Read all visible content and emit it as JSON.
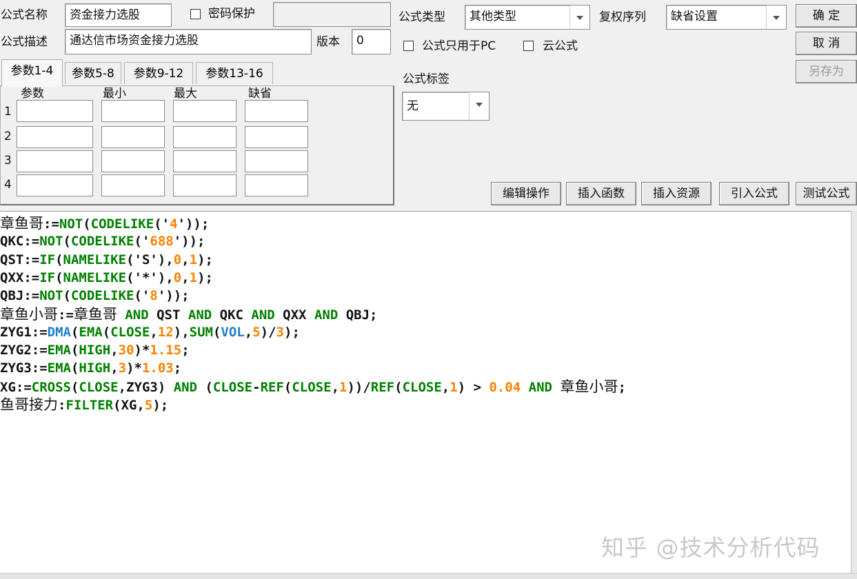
{
  "form": {
    "name_label": "公式名称",
    "name_value": "资金接力选股",
    "password_label": "密码保护",
    "password_value": "",
    "desc_label": "公式描述",
    "desc_value": "通达信市场资金接力选股",
    "version_label": "版本",
    "version_value": "0",
    "type_label": "公式类型",
    "type_value": "其他类型",
    "rights_label": "复权序列",
    "rights_value": "缺省设置",
    "pc_only_label": "公式只用于PC",
    "cloud_label": "云公式",
    "tag_label": "公式标签",
    "tag_value": "无"
  },
  "buttons": {
    "ok": "确 定",
    "cancel": "取 消",
    "save_as": "另存为",
    "edit_ops": "编辑操作",
    "insert_func": "插入函数",
    "insert_res": "插入资源",
    "import_formula": "引入公式",
    "test_formula": "测试公式"
  },
  "params": {
    "tabs": [
      "参数1-4",
      "参数5-8",
      "参数9-12",
      "参数13-16"
    ],
    "columns": [
      "参数",
      "最小",
      "最大",
      "缺省"
    ],
    "rows": [
      "1",
      "2",
      "3",
      "4"
    ]
  },
  "code_lines": [
    [
      [
        "k",
        "章鱼哥:="
      ],
      [
        "g",
        "NOT"
      ],
      [
        "k",
        "("
      ],
      [
        "g",
        "CODELIKE"
      ],
      [
        "k",
        "('"
      ],
      [
        "o",
        "4"
      ],
      [
        "k",
        "'));"
      ]
    ],
    [
      [
        "k",
        "QKC:="
      ],
      [
        "g",
        "NOT"
      ],
      [
        "k",
        "("
      ],
      [
        "g",
        "CODELIKE"
      ],
      [
        "k",
        "('"
      ],
      [
        "o",
        "688"
      ],
      [
        "k",
        "'));"
      ]
    ],
    [
      [
        "k",
        "QST:="
      ],
      [
        "g",
        "IF"
      ],
      [
        "k",
        "("
      ],
      [
        "g",
        "NAMELIKE"
      ],
      [
        "k",
        "('S'),"
      ],
      [
        "o",
        "0"
      ],
      [
        "k",
        ","
      ],
      [
        "o",
        "1"
      ],
      [
        "k",
        ");"
      ]
    ],
    [
      [
        "k",
        "QXX:="
      ],
      [
        "g",
        "IF"
      ],
      [
        "k",
        "("
      ],
      [
        "g",
        "NAMELIKE"
      ],
      [
        "k",
        "('*'),"
      ],
      [
        "o",
        "0"
      ],
      [
        "k",
        ","
      ],
      [
        "o",
        "1"
      ],
      [
        "k",
        ");"
      ]
    ],
    [
      [
        "k",
        "QBJ:="
      ],
      [
        "g",
        "NOT"
      ],
      [
        "k",
        "("
      ],
      [
        "g",
        "CODELIKE"
      ],
      [
        "k",
        "('"
      ],
      [
        "o",
        "8"
      ],
      [
        "k",
        "'));"
      ]
    ],
    [
      [
        "k",
        "章鱼小哥:=章鱼哥 "
      ],
      [
        "g",
        "AND"
      ],
      [
        "k",
        " QST "
      ],
      [
        "g",
        "AND"
      ],
      [
        "k",
        " QKC "
      ],
      [
        "g",
        "AND"
      ],
      [
        "k",
        " QXX "
      ],
      [
        "g",
        "AND"
      ],
      [
        "k",
        " QBJ;"
      ]
    ],
    [
      [
        "k",
        "ZYG1:="
      ],
      [
        "b",
        "DMA"
      ],
      [
        "k",
        "("
      ],
      [
        "g",
        "EMA"
      ],
      [
        "k",
        "("
      ],
      [
        "g",
        "CLOSE"
      ],
      [
        "k",
        ","
      ],
      [
        "o",
        "12"
      ],
      [
        "k",
        "),"
      ],
      [
        "g",
        "SUM"
      ],
      [
        "k",
        "("
      ],
      [
        "b",
        "VOL"
      ],
      [
        "k",
        ","
      ],
      [
        "o",
        "5"
      ],
      [
        "k",
        ")/"
      ],
      [
        "o",
        "3"
      ],
      [
        "k",
        ");"
      ]
    ],
    [
      [
        "k",
        "ZYG2:="
      ],
      [
        "g",
        "EMA"
      ],
      [
        "k",
        "("
      ],
      [
        "g",
        "HIGH"
      ],
      [
        "k",
        ","
      ],
      [
        "o",
        "30"
      ],
      [
        "k",
        ")*"
      ],
      [
        "o",
        "1.15"
      ],
      [
        "k",
        ";"
      ]
    ],
    [
      [
        "k",
        "ZYG3:="
      ],
      [
        "g",
        "EMA"
      ],
      [
        "k",
        "("
      ],
      [
        "g",
        "HIGH"
      ],
      [
        "k",
        ","
      ],
      [
        "o",
        "3"
      ],
      [
        "k",
        ")*"
      ],
      [
        "o",
        "1.03"
      ],
      [
        "k",
        ";"
      ]
    ],
    [
      [
        "k",
        "XG:="
      ],
      [
        "g",
        "CROSS"
      ],
      [
        "k",
        "("
      ],
      [
        "g",
        "CLOSE"
      ],
      [
        "k",
        ",ZYG3) "
      ],
      [
        "g",
        "AND"
      ],
      [
        "k",
        " ("
      ],
      [
        "g",
        "CLOSE"
      ],
      [
        "k",
        "-"
      ],
      [
        "g",
        "REF"
      ],
      [
        "k",
        "("
      ],
      [
        "g",
        "CLOSE"
      ],
      [
        "k",
        ","
      ],
      [
        "o",
        "1"
      ],
      [
        "k",
        "))/"
      ],
      [
        "g",
        "REF"
      ],
      [
        "k",
        "("
      ],
      [
        "g",
        "CLOSE"
      ],
      [
        "k",
        ","
      ],
      [
        "o",
        "1"
      ],
      [
        "k",
        ") > "
      ],
      [
        "o",
        "0.04"
      ],
      [
        "k",
        " "
      ],
      [
        "g",
        "AND"
      ],
      [
        "k",
        " 章鱼小哥;"
      ]
    ],
    [
      [
        "k",
        "鱼哥接力:"
      ],
      [
        "g",
        "FILTER"
      ],
      [
        "k",
        "(XG,"
      ],
      [
        "o",
        "5"
      ],
      [
        "k",
        ");"
      ]
    ]
  ],
  "watermark": "知乎 @技术分析代码",
  "colors": {
    "keyword": "#008000",
    "number": "#ff8000",
    "builtin": "#1e7fcf",
    "text": "#111111"
  }
}
